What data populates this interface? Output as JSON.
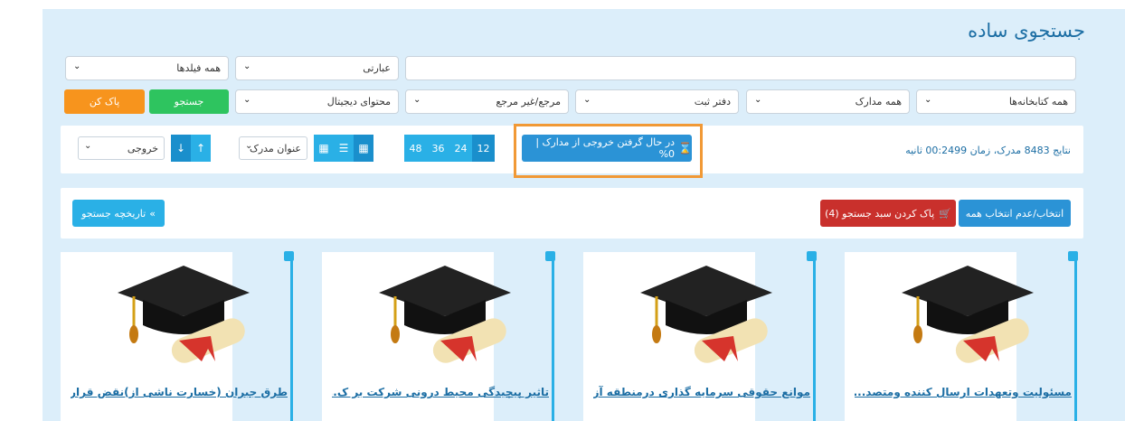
{
  "page_title": "جستجوی ساده",
  "row1": {
    "search_value": "",
    "phrase_select": "عبارتی",
    "fields_select": "همه فیلدها"
  },
  "row2": {
    "libraries_select": "همه کتابخانه‌ها",
    "documents_select": "همه مدارک",
    "registry_select": "دفتر ثبت",
    "reference_select": "مرجع/غیر مرجع",
    "digital_select": "محتوای دیجیتال",
    "search_button": "جستجو",
    "clear_button": "پاک کن"
  },
  "toolbar": {
    "results_text": "نتایج 8483 مدرک، زمان 00:2499 ثانیه",
    "export_status": "در حال گرفتن خروجی از مدارک | 0%",
    "page_sizes": [
      "12",
      "24",
      "36",
      "48"
    ],
    "active_page_size": "12",
    "sort_select": "عنوان مدرک",
    "output_select": "خروجی"
  },
  "actions": {
    "select_all": "انتخاب/عدم انتخاب همه",
    "clear_basket": "پاک کردن سبد جستجو (4)",
    "search_history": "تاریخچه جستجو"
  },
  "results": [
    {
      "title": "مسئولیت وتعهدات ارسال کننده ومتصد..."
    },
    {
      "title": "موانع حقوقی سرمایه گذاری درمنطقه آز..."
    },
    {
      "title": "تاثیر پیچیدگی محیط درونی شرکت بر ک..."
    },
    {
      "title": "طرق جبران (خسارت ناشی از)نقض قرار..."
    }
  ],
  "colors": {
    "panel_bg": "#dceefa",
    "primary_blue": "#2b93d6",
    "light_blue": "#2ab0e6",
    "green": "#2ec45f",
    "orange": "#f7941d",
    "red": "#c9302c",
    "highlight": "#f19936"
  }
}
